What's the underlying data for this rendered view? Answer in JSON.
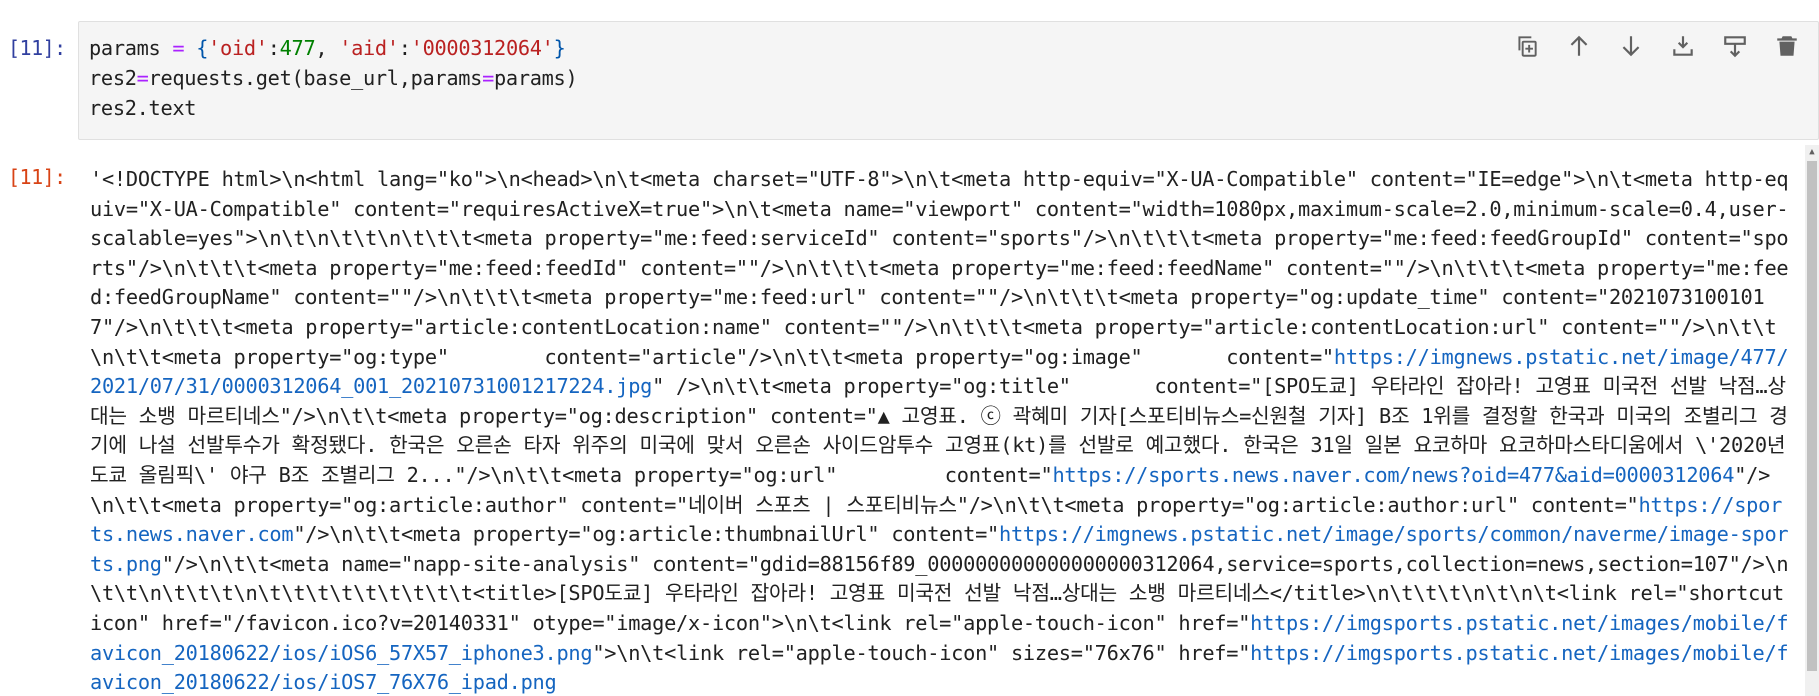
{
  "input_cell": {
    "prompt": "[11]:",
    "code": {
      "line1": {
        "v1": "params ",
        "op": "=",
        "sp": " ",
        "b1": "{",
        "s1": "'oid'",
        "c1": ":",
        "n1": "477",
        "cm": ", ",
        "s2": "'aid'",
        "c2": ":",
        "s3": "'0000312064'",
        "b2": "}"
      },
      "line2": {
        "a": "res2",
        "op": "=",
        "b": "requests.get(base_url,params",
        "op2": "=",
        "c": "params)"
      },
      "line3": "res2.text"
    },
    "toolbar": [
      {
        "name": "copy-icon"
      },
      {
        "name": "move-up-icon"
      },
      {
        "name": "move-down-icon"
      },
      {
        "name": "insert-below-icon"
      },
      {
        "name": "insert-above-icon"
      },
      {
        "name": "delete-icon"
      }
    ]
  },
  "output_cell": {
    "prompt": "[11]:",
    "segments": [
      {
        "t": "'<!DOCTYPE html>\\n<html lang=\"ko\">\\n<head>\\n\\t<meta charset=\"UTF-8\">\\n\\t<meta http-equiv=\"X-UA-Compatible\" content=\"IE=edge\">\\n\\t<meta http-equiv=\"X-UA-Compatible\" content=\"requiresActiveX=true\">\\n\\t<meta name=\"viewport\" content=\"width=1080px,maximum-scale=2.0,minimum-scale=0.4,user-scalable=yes\">\\n\\t\\n\\t\\t\\n\\t\\t\\t<meta property=\"me:feed:serviceId\" content=\"sports\"/>\\n\\t\\t\\t<meta property=\"me:feed:feedGroupId\" content=\"sports\"/>\\n\\t\\t\\t<meta property=\"me:feed:feedId\" content=\"\"/>\\n\\t\\t\\t<meta property=\"me:feed:feedName\" content=\"\"/>\\n\\t\\t\\t<meta property=\"me:feed:feedGroupName\" content=\"\"/>\\n\\t\\t\\t<meta property=\"me:feed:url\" content=\"\"/>\\n\\t\\t\\t<meta property=\"og:update_time\" content=\"20210731001017\"/>\\n\\t\\t\\t<meta property=\"article:contentLocation:name\" content=\"\"/>\\n\\t\\t\\t<meta property=\"article:contentLocation:url\" content=\"\"/>\\n\\t\\t\\n\\t\\t<meta property=\"og:type\"        content=\"article\"/>\\n\\t\\t<meta property=\"og:image\"       content=\"",
        "link": false
      },
      {
        "t": "https://imgnews.pstatic.net/image/477/2021/07/31/0000312064_001_20210731001217224.jpg",
        "link": true
      },
      {
        "t": "\" />\\n\\t\\t<meta property=\"og:title\"       content=\"[SPO도쿄] 우타라인 잡아라! 고영표 미국전 선발 낙점…상대는 소뱅 마르티네스\"/>\\n\\t\\t<meta property=\"og:description\" content=\"▲ 고영표. ⓒ 곽혜미 기자[스포티비뉴스=신원철 기자] B조 1위를 결정할 한국과 미국의 조별리그 경기에 나설 선발투수가 확정됐다. 한국은 오른손 타자 위주의 미국에 맞서 오른손 사이드암투수 고영표(kt)를 선발로 예고했다. 한국은 31일 일본 요코하마 요코하마스타디움에서 \\'2020년 도쿄 올림픽\\' 야구 B조 조별리그 2...\"/>\\n\\t\\t<meta property=\"og:url\"         content=\"",
        "link": false
      },
      {
        "t": "https://sports.news.naver.com/news?oid=477&aid=0000312064",
        "link": true
      },
      {
        "t": "\"/>\\n\\t\\t<meta property=\"og:article:author\" content=\"네이버 스포츠 | 스포티비뉴스\"/>\\n\\t\\t<meta property=\"og:article:author:url\" content=\"",
        "link": false
      },
      {
        "t": "https://sports.news.naver.com",
        "link": true
      },
      {
        "t": "\"/>\\n\\t\\t<meta property=\"og:article:thumbnailUrl\" content=\"",
        "link": false
      },
      {
        "t": "https://imgnews.pstatic.net/image/sports/common/naverme/image-sports.png",
        "link": true
      },
      {
        "t": "\"/>\\n\\t\\t<meta name=\"napp-site-analysis\" content=\"gdid=88156f89_000000000000000000312064,service=sports,collection=news,section=107\"/>\\n\\t\\t\\n\\t\\t\\t\\n\\t\\t\\t\\t\\t\\t\\t\\t\\t<title>[SPO도쿄] 우타라인 잡아라! 고영표 미국전 선발 낙점…상대는 소뱅 마르티네스</title>\\n\\t\\t\\t\\n\\t\\n\\t<link rel=\"shortcut icon\" href=\"/favicon.ico?v=20140331\" otype=\"image/x-icon\">\\n\\t<link rel=\"apple-touch-icon\" href=\"",
        "link": false
      },
      {
        "t": "https://imgsports.pstatic.net/images/mobile/favicon_20180622/ios/iOS6_57X57_iphone3.png",
        "link": true
      },
      {
        "t": "\">\\n\\t<link rel=\"apple-touch-icon\" sizes=\"76x76\" href=\"",
        "link": false
      },
      {
        "t": "https://imgsports.pstatic.net/images/mobile/favicon_20180622/ios/iOS7_76X76_ipad.png",
        "link": true
      }
    ]
  }
}
